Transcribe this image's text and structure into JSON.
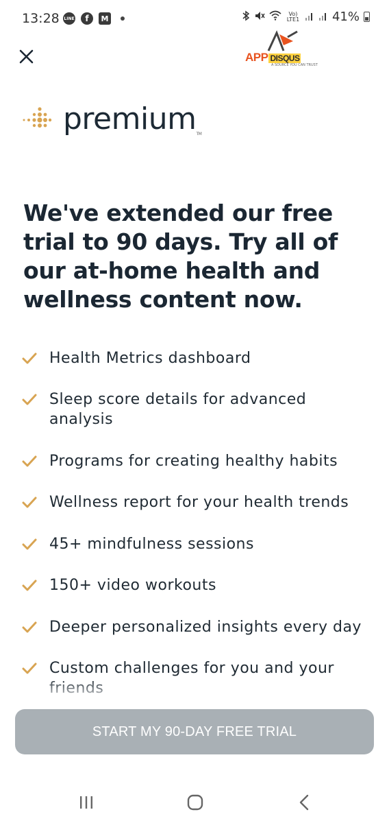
{
  "status_bar": {
    "time": "13:28",
    "apps": [
      {
        "icon": "line-icon",
        "label": "LINE"
      },
      {
        "icon": "facebook-icon",
        "label": "f"
      },
      {
        "icon": "gmail-icon",
        "label": "M"
      }
    ],
    "network": "Vo) LTE1",
    "battery": "41%"
  },
  "watermark": {
    "brand_a": "APP",
    "brand_b": "DISQUS",
    "tagline": "A SOURCE YOU CAN TRUST"
  },
  "logo": {
    "word": "premium",
    "tm": "TM",
    "accent_color": "#d8a452"
  },
  "headline": "We've extended our free trial to 90 days. Try all of our at-home health and wellness content now.",
  "features": [
    "Health Metrics dashboard",
    "Sleep score details for advanced analysis",
    "Programs for creating healthy habits",
    "Wellness report for your health trends",
    "45+ mindfulness sessions",
    "150+ video workouts",
    "Deeper personalized insights every day",
    "Custom challenges for you and your friends"
  ],
  "cta": {
    "label": "START MY 90-DAY FREE TRIAL",
    "color": "#a9b0b5"
  },
  "navbar": {
    "icons": [
      "recent-apps-icon",
      "home-icon",
      "back-icon"
    ]
  },
  "colors": {
    "check": "#d8a452",
    "text": "#1b2733"
  }
}
